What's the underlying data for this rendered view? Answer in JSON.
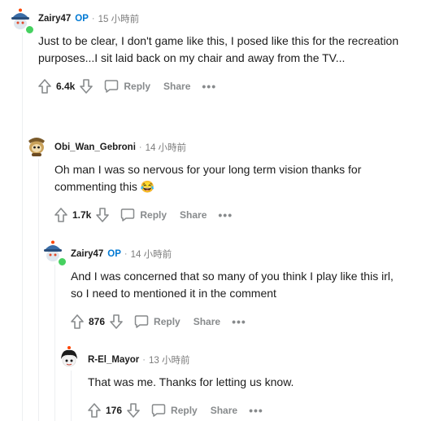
{
  "comments": [
    {
      "author": "Zairy47",
      "op_badge": "OP",
      "time": "15 小時前",
      "body": "Just to be clear, I don't game like this, I posed like this for the recreation purposes...I sit laid back on my chair and away from the TV...",
      "votes": "6.4k",
      "reply_label": "Reply",
      "share_label": "Share",
      "avatar_icon": "snoo-avatar-blue-hat-icon",
      "online": true
    },
    {
      "author": "Obi_Wan_Gebroni",
      "time": "14 小時前",
      "body": "Oh man I was so nervous for your long term vision thanks for commenting this",
      "emoji": "😂",
      "votes": "1.7k",
      "reply_label": "Reply",
      "share_label": "Share",
      "avatar_icon": "snoo-avatar-gold-icon"
    },
    {
      "author": "Zairy47",
      "op_badge": "OP",
      "time": "14 小時前",
      "body": "And I was concerned that so many of you think I play like this irl, so I need to mentioned it in the comment",
      "votes": "876",
      "reply_label": "Reply",
      "share_label": "Share",
      "avatar_icon": "snoo-avatar-blue-hat-icon",
      "online": true
    },
    {
      "author": "R-El_Mayor",
      "time": "13 小時前",
      "body": "That was me. Thanks for letting us know.",
      "votes": "176",
      "reply_label": "Reply",
      "share_label": "Share",
      "avatar_icon": "snoo-avatar-black-hair-icon"
    }
  ],
  "colors": {
    "op_blue": "#0079d3",
    "online_green": "#46d160",
    "meta_gray": "#878a8c",
    "thread_line": "#edeff1"
  }
}
